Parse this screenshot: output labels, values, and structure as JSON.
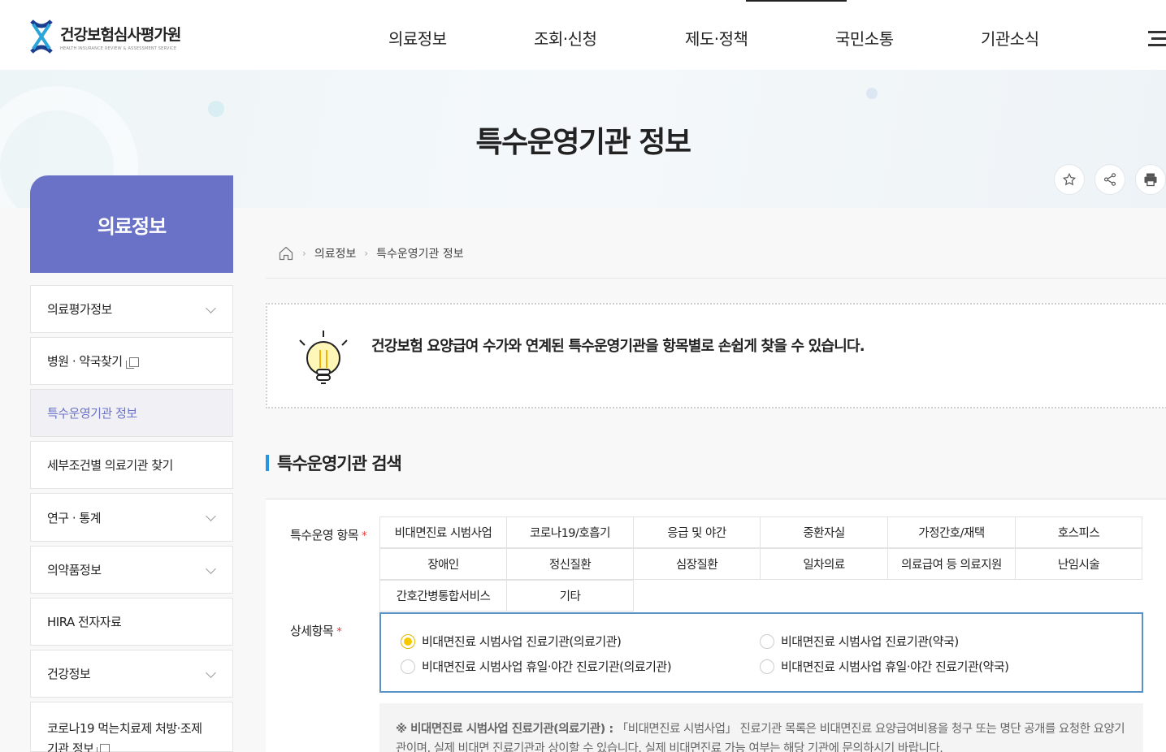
{
  "header": {
    "logo_name": "건강보험심사평가원",
    "logo_sub": "HEALTH INSURANCE REVIEW & ASSESSMENT SERVICE",
    "nav": [
      "의료정보",
      "조회·신청",
      "제도·정책",
      "국민소통",
      "기관소식"
    ]
  },
  "hero": {
    "title": "특수운영기관 정보"
  },
  "sidebar": {
    "heading": "의료정보",
    "items": [
      {
        "label": "의료평가정보"
      },
      {
        "label": "병원 · 약국찾기"
      },
      {
        "label": "특수운영기관 정보"
      },
      {
        "label": "세부조건별 의료기관 찾기"
      },
      {
        "label": "연구 · 통계"
      },
      {
        "label": "의약품정보"
      },
      {
        "label": "HIRA 전자자료"
      },
      {
        "label": "건강정보"
      },
      {
        "label": "코로나19 먹는치료제 처방·조제"
      },
      {
        "label": "기관 정보"
      }
    ]
  },
  "breadcrumb": [
    "의료정보",
    "특수운영기관 정보"
  ],
  "notice": {
    "text": "건강보험 요양급여 수가와 연계된 특수운영기관을 항목별로 손쉽게 찾을 수 있습니다."
  },
  "search": {
    "title": "특수운영기관 검색",
    "category_label": "특수운영 항목",
    "required_mark": "*",
    "categories": [
      "비대면진료 시범사업",
      "코로나19/호흡기",
      "응급 및 야간",
      "중환자실",
      "가정간호/재택",
      "호스피스",
      "장애인",
      "정신질환",
      "심장질환",
      "일차의료",
      "의료급여 등 의료지원",
      "난임시술",
      "간호간병통합서비스",
      "기타"
    ],
    "detail_label": "상세항목",
    "details": [
      {
        "label": "비대면진료 시범사업 진료기관(의료기관)",
        "checked": true
      },
      {
        "label": "비대면진료 시범사업 진료기관(약국)",
        "checked": false
      },
      {
        "label": "비대면진료 시범사업 휴일·야간 진료기관(의료기관)",
        "checked": false
      },
      {
        "label": "비대면진료 시범사업 휴일·야간 진료기관(약국)",
        "checked": false
      }
    ],
    "note_title": "※ 비대면진료 시범사업 진료기관(의료기관) :",
    "note_body": "「비대면진료 시범사업」 진료기관 목록은 비대면진료 요양급여비용을 청구 또는 명단 공개를 요청한 요양기관이며, 실제 비대면 진료기관과 상이할 수 있습니다. 실제 비대면진료 가능 여부는 해당 기관에 문의하시기 바랍니다."
  },
  "colors": {
    "accent": "#6a72c8",
    "section_bar": "#2596e3",
    "detail_border": "#5a92c8",
    "radio_on": "#f5c800"
  }
}
